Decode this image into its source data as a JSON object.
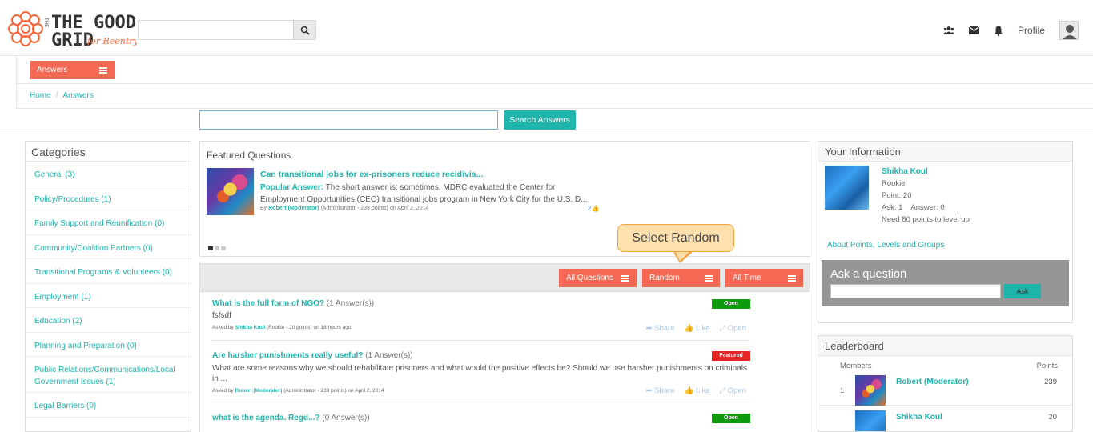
{
  "brand": {
    "logo_line1": "THE GOOD",
    "logo_line2": "GRID",
    "logo_tagline": "for Reentry",
    "logo_color": "#f4683c",
    "accent": "#f56954",
    "teal": "#1fb5ac"
  },
  "header": {
    "profile_label": "Profile",
    "search_value": ""
  },
  "menu": {
    "answers_label": "Answers"
  },
  "breadcrumb": [
    "Home",
    "Answers"
  ],
  "answers_search": {
    "value": "",
    "button_label": "Search Answers"
  },
  "categories": {
    "title": "Categories",
    "items": [
      "General (3)",
      "Policy/Procedures (1)",
      "Family Support and Reunification (0)",
      "Community/Coalition Partners (0)",
      "Transitional Programs & Volunteers (0)",
      "Employment (1)",
      "Education (2)",
      "Planning and Preparation (0)",
      "Public Relations/Communications/Local Government Issues (1)",
      "Legal Barriers (0)"
    ]
  },
  "featured": {
    "title": "Featured Questions",
    "question": "Can transitional jobs for ex-prisoners reduce recidivis...",
    "popular_label": "Popular Answer:",
    "answer": " The short answer is: sometimes. MDRC evaluated the Center for Employment Opportunities (CEO) transitional jobs program in New York City for the U.S. D...",
    "by_prefix": "By",
    "by_user": "Robert (Moderator)",
    "by_suffix": "(Administrator - 239 points)  on April 2, 2014",
    "likes": "2"
  },
  "callout": "Select Random",
  "filters": {
    "questions": "All Questions",
    "order": "Random",
    "time": "All Time"
  },
  "questions": [
    {
      "title": "What is the full form of NGO?",
      "answers": "(1 Answer(s))",
      "body": "fsfsdf",
      "asked_prefix": "Asked by",
      "user": "Shikha Koul",
      "meta": "(Rookie - 20 points)  on 18 hours ago",
      "badge": "Open",
      "badge_color": "#0e9a0e"
    },
    {
      "title": "Are harsher punishments really useful?",
      "answers": "(1 Answer(s))",
      "body": "What are some reasons why we should rehabilitate prisoners and what would the positive effects be? Should we use harsher punishments on criminals in ...",
      "asked_prefix": "Asked by",
      "user": "Robert (Moderator)",
      "meta": "(Administrator - 239 points)  on April 2, 2014",
      "badge": "Featured",
      "badge_color": "#e52424"
    },
    {
      "title": "what is the agenda. Regd...?",
      "answers": "(0 Answer(s))",
      "badge": "Open",
      "badge_color": "#0e9a0e"
    }
  ],
  "actions": {
    "share": "Share",
    "like": "Like",
    "open": "Open"
  },
  "your_info": {
    "title": "Your Information",
    "name": "Shikha Koul",
    "rank": "Rookie",
    "points": "Point: 20",
    "ask_answer": "Ask: 1    Answer: 0",
    "level_msg": "Need 80 points to level up",
    "about_link": "About Points, Levels and Groups"
  },
  "ask": {
    "title": "Ask a question",
    "button_label": "Ask",
    "value": ""
  },
  "leaderboard": {
    "title": "Leaderboard",
    "col_members": "Members",
    "col_points": "Points",
    "rows": [
      {
        "rank": "1",
        "name": "Robert (Moderator)",
        "points": "239"
      },
      {
        "rank": "",
        "name": "Shikha Koul",
        "points": "20"
      }
    ]
  }
}
